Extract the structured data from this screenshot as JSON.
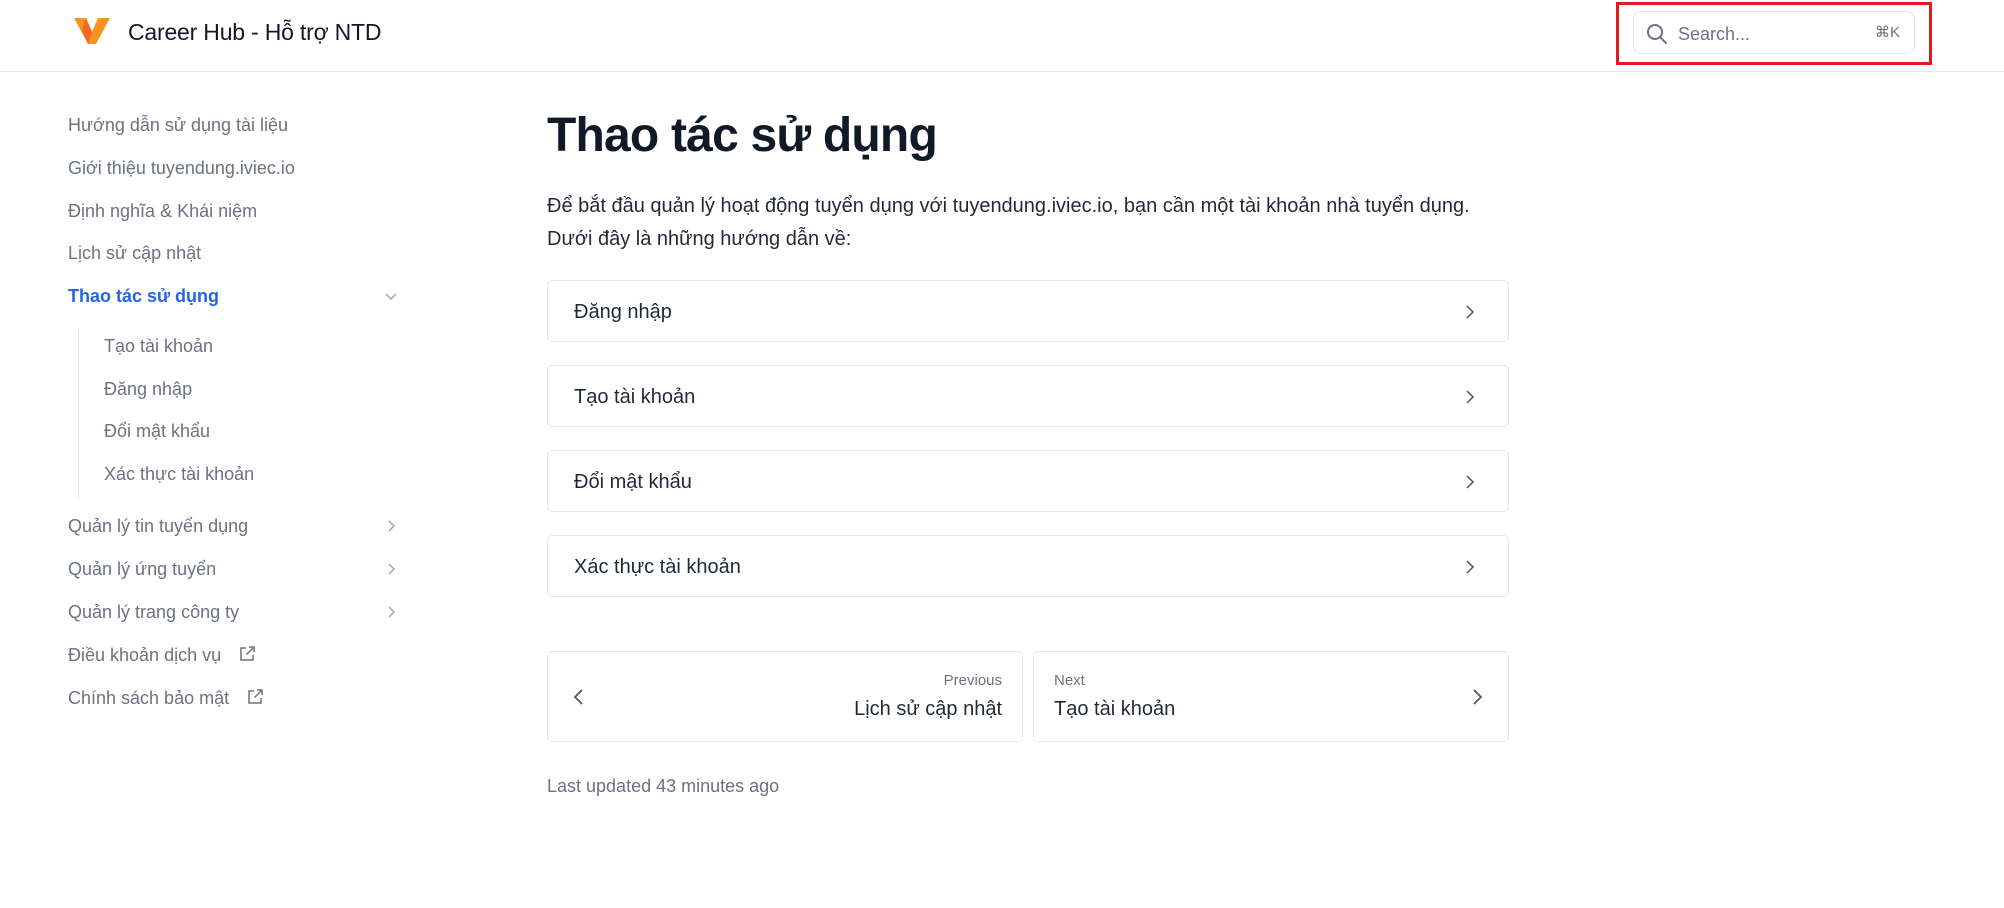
{
  "header": {
    "site_title": "Career Hub - Hỗ trợ NTD",
    "logo_icon": "v-logo-icon",
    "search": {
      "placeholder": "Search...",
      "shortcut": "⌘K",
      "icon": "search-icon"
    }
  },
  "sidebar": {
    "items": [
      {
        "label": "Hướng dẫn sử dụng tài liệu"
      },
      {
        "label": "Giới thiệu tuyendung.iviec.io"
      },
      {
        "label": "Định nghĩa & Khái niệm"
      },
      {
        "label": "Lịch sử cập nhật"
      },
      {
        "label": "Thao tác sử dụng",
        "active": true,
        "expanded": true
      },
      {
        "label": "Quản lý tin tuyển dụng"
      },
      {
        "label": "Quản lý ứng tuyển"
      },
      {
        "label": "Quản lý trang công ty"
      },
      {
        "label": "Điều khoản dịch vụ",
        "external": true
      },
      {
        "label": "Chính sách bảo mật",
        "external": true
      }
    ],
    "subitems": [
      {
        "label": "Tạo tài khoản"
      },
      {
        "label": "Đăng nhập"
      },
      {
        "label": "Đổi mật khẩu"
      },
      {
        "label": "Xác thực tài khoản"
      }
    ]
  },
  "main": {
    "title": "Thao tác sử dụng",
    "intro": "Để bắt đầu quản lý hoạt động tuyển dụng với tuyendung.iviec.io, bạn cần một tài khoản nhà tuyển dụng. Dưới đây là những hướng dẫn về:",
    "cards": [
      {
        "label": "Đăng nhập"
      },
      {
        "label": "Tạo tài khoản"
      },
      {
        "label": "Đổi mật khẩu"
      },
      {
        "label": "Xác thực tài khoản"
      }
    ],
    "pager": {
      "prev_small": "Previous",
      "prev_title": "Lịch sử cập nhật",
      "next_small": "Next",
      "next_title": "Tạo tài khoản"
    },
    "last_updated": "Last updated 43 minutes ago"
  },
  "colors": {
    "accent": "#2563eb",
    "logo_orange": "#f7941d",
    "highlight_red": "#e3191d"
  }
}
